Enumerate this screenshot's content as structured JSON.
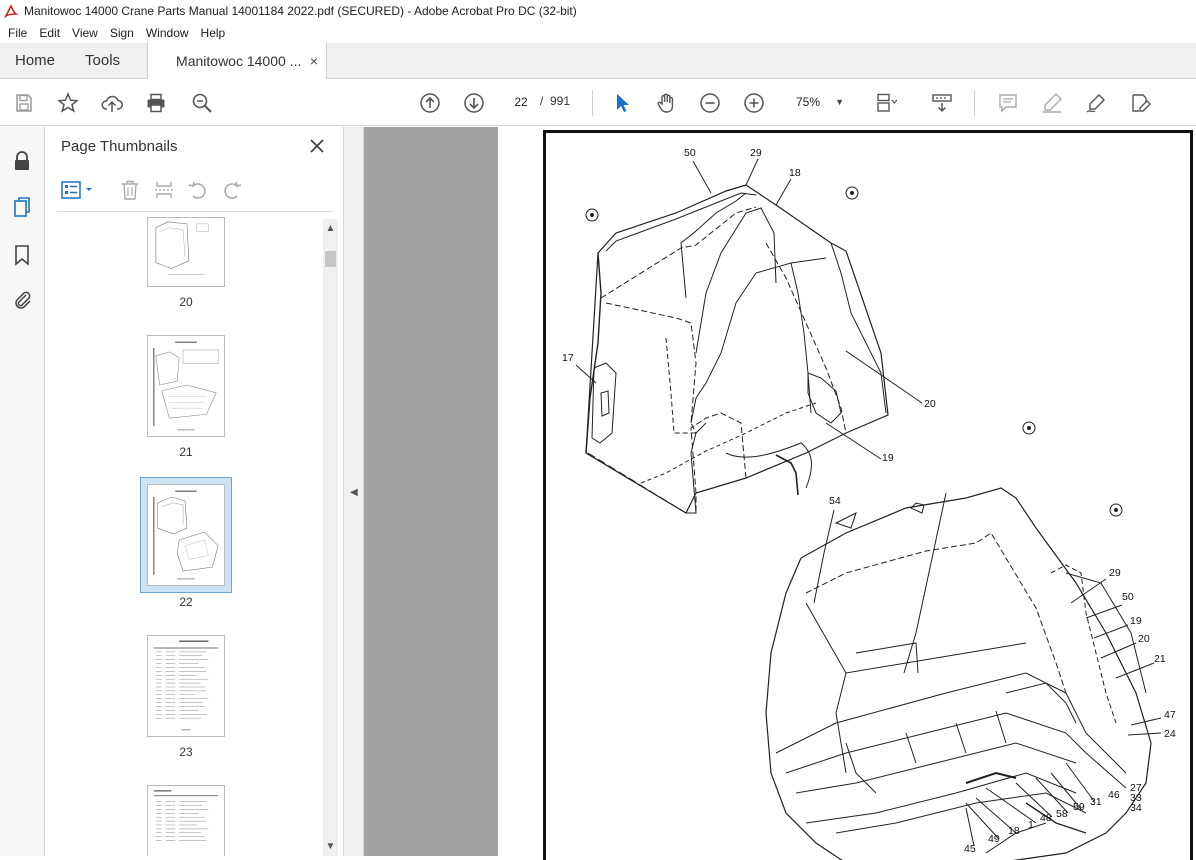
{
  "window": {
    "title": "Manitowoc 14000 Crane Parts Manual 14001184 2022.pdf (SECURED) - Adobe Acrobat Pro DC (32-bit)"
  },
  "menu": [
    "File",
    "Edit",
    "View",
    "Sign",
    "Window",
    "Help"
  ],
  "tabs": {
    "home": "Home",
    "tools": "Tools",
    "document": "Manitowoc 14000 ...",
    "document_close": "×"
  },
  "toolbar": {
    "current_page": "22",
    "page_separator": "/",
    "total_pages": "991",
    "zoom": "75%"
  },
  "panel": {
    "title": "Page Thumbnails",
    "close": "×"
  },
  "thumbnails": [
    {
      "label": "20"
    },
    {
      "label": "21"
    },
    {
      "label": "22",
      "selected": true
    },
    {
      "label": "23"
    },
    {
      "label": ""
    }
  ],
  "callouts": [
    {
      "text": "50"
    },
    {
      "text": "29"
    },
    {
      "text": "18"
    },
    {
      "text": "17"
    },
    {
      "text": "20"
    },
    {
      "text": "19"
    },
    {
      "text": "54"
    },
    {
      "text": "29"
    },
    {
      "text": "50"
    },
    {
      "text": "19"
    },
    {
      "text": "20"
    },
    {
      "text": "21"
    },
    {
      "text": "47"
    },
    {
      "text": "24"
    },
    {
      "text": "27"
    },
    {
      "text": "33"
    },
    {
      "text": "34"
    },
    {
      "text": "46"
    },
    {
      "text": "31"
    },
    {
      "text": "59"
    },
    {
      "text": "58"
    },
    {
      "text": "48"
    },
    {
      "text": "1"
    },
    {
      "text": "18"
    },
    {
      "text": "49"
    },
    {
      "text": "45"
    }
  ],
  "colors": {
    "accent_red": "#d6251f",
    "selection_blue": "#6aa7d6",
    "doc_background": "#a3a3a3"
  }
}
